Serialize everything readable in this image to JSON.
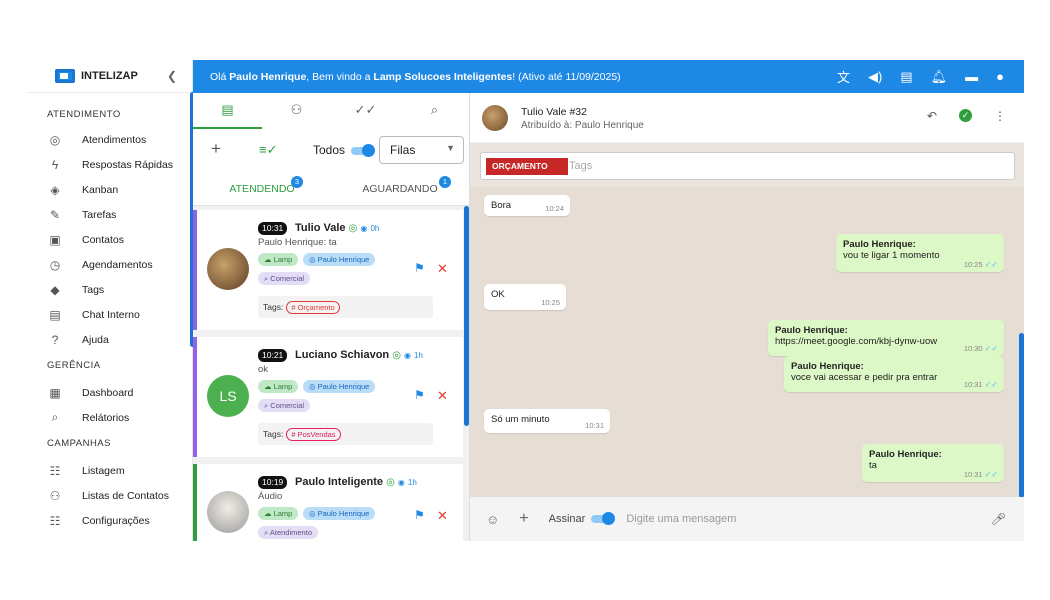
{
  "brand": {
    "name": "INTELIZAP"
  },
  "sidebar": {
    "sections": [
      {
        "title": "ATENDIMENTO",
        "items": [
          {
            "label": "Atendimentos",
            "icon": "whatsapp-icon"
          },
          {
            "label": "Respostas Rápidas",
            "icon": "bolt-icon"
          },
          {
            "label": "Kanban",
            "icon": "tag-icon"
          },
          {
            "label": "Tarefas",
            "icon": "pencil-icon"
          },
          {
            "label": "Contatos",
            "icon": "contact-card-icon"
          },
          {
            "label": "Agendamentos",
            "icon": "clock-icon"
          },
          {
            "label": "Tags",
            "icon": "label-icon"
          },
          {
            "label": "Chat Interno",
            "icon": "chat-icon"
          },
          {
            "label": "Ajuda",
            "icon": "help-icon"
          }
        ]
      },
      {
        "title": "GERÊNCIA",
        "items": [
          {
            "label": "Dashboard",
            "icon": "dashboard-icon"
          },
          {
            "label": "Relátorios",
            "icon": "search-icon"
          }
        ]
      },
      {
        "title": "CAMPANHAS",
        "items": [
          {
            "label": "Listagem",
            "icon": "list-icon"
          },
          {
            "label": "Listas de Contatos",
            "icon": "people-icon"
          },
          {
            "label": "Configurações",
            "icon": "settings-list-icon"
          }
        ]
      }
    ]
  },
  "topbar": {
    "greeting": "Olá ",
    "user": "Paulo Henrique",
    "welcome": ", Bem vindo a ",
    "company": "Lamp Solucoes Inteligentes",
    "active_until": "! (Ativo até 11/09/2025)"
  },
  "list": {
    "todos_label": "Todos",
    "filas_label": "Filas",
    "tab_atendendo": "ATENDENDO",
    "tab_atendendo_count": "3",
    "tab_aguardando": "AGUARDANDO",
    "tab_aguardando_count": "1",
    "tickets": [
      {
        "time": "10:31",
        "name": "Tulio Vale",
        "duration": "0h",
        "message": "Paulo Henrique: ta",
        "connection": "Lamp",
        "user": "Paulo Henrique",
        "queue": "Comercial",
        "tags_label": "Tags:",
        "tag": "# Orçamento"
      },
      {
        "time": "10:21",
        "name": "Luciano Schiavon",
        "duration": "1h",
        "message": "ok",
        "initials": "LS",
        "connection": "Lamp",
        "user": "Paulo Henrique",
        "queue": "Comercial",
        "tags_label": "Tags:",
        "tag": "# PosVendas"
      },
      {
        "time": "10:19",
        "name": "Paulo Inteligente",
        "duration": "1h",
        "message": "Áudio",
        "connection": "Lamp",
        "user": "Paulo Henrique",
        "queue": "Atendimento"
      }
    ]
  },
  "chat": {
    "title": "Tulio Vale #32",
    "assigned": "Atribuído à: Paulo Henrique",
    "tag": "ORÇAMENTO",
    "tags_placeholder": "Tags",
    "messages": [
      {
        "dir": "in",
        "text": "Bora",
        "time": "10:24"
      },
      {
        "dir": "out",
        "sender": "Paulo Henrique:",
        "text": "vou te ligar 1 momento",
        "time": "10:25"
      },
      {
        "dir": "in",
        "text": "OK",
        "time": "10:25"
      },
      {
        "dir": "out",
        "sender": "Paulo Henrique:",
        "text": "https://meet.google.com/kbj-dynw-uow",
        "time": "10:30"
      },
      {
        "dir": "out",
        "sender": "Paulo Henrique:",
        "text": "voce vai acessar e pedir pra entrar",
        "time": "10:31"
      },
      {
        "dir": "in",
        "text": "Só um minuto",
        "time": "10:31"
      },
      {
        "dir": "out",
        "sender": "Paulo Henrique:",
        "text": "ta",
        "time": "10:31"
      }
    ],
    "sign_label": "Assinar",
    "input_placeholder": "Digite uma mensagem"
  },
  "colors": {
    "primary": "#1e88e5",
    "green": "#2e9e3f",
    "danger": "#e53935"
  }
}
